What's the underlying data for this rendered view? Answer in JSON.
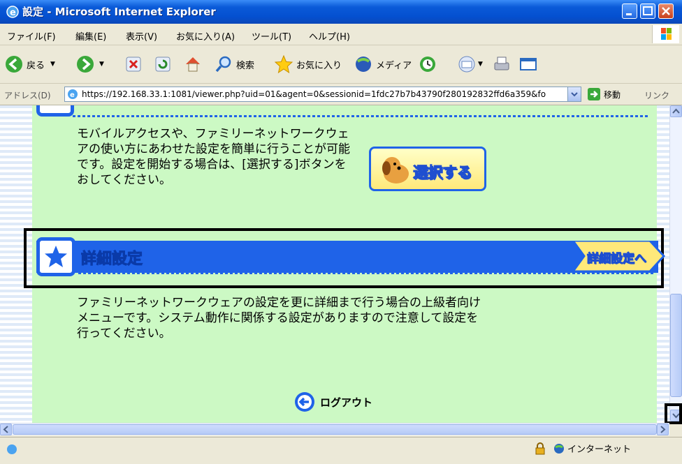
{
  "window": {
    "title": "設定 - Microsoft Internet Explorer"
  },
  "menu": {
    "items": [
      "ファイル(F)",
      "編集(E)",
      "表示(V)",
      "お気に入り(A)",
      "ツール(T)",
      "ヘルプ(H)"
    ]
  },
  "toolbar": {
    "back": "戻る",
    "search": "検索",
    "favorites": "お気に入り",
    "media": "メディア"
  },
  "address": {
    "label": "アドレス(D)",
    "url": "https://192.168.33.1:1081/viewer.php?uid=01&agent=0&sessionid=1fdc27b7b43790f280192832ffd6a359&fo",
    "go": "移動",
    "links": "リンク"
  },
  "content": {
    "intro_text": "モバイルアクセスや、ファミリーネットワークウェアの使い方にあわせた設定を簡単に行うことが可能です。設定を開始する場合は、[選択する]ボタンをおしてください。",
    "select_button": "選択する",
    "advanced_heading": "詳細設定",
    "advanced_link": "詳細設定へ",
    "advanced_text": "ファミリーネットワークウェアの設定を更に詳細まで行う場合の上級者向けメニューです。システム動作に関係する設定がありますので注意して設定を行ってください。",
    "logout": "ログアウト"
  },
  "status": {
    "zone": "インターネット"
  },
  "colors": {
    "accent_blue": "#1f63e8",
    "page_green": "#ccf9c4",
    "titlebar_blue": "#0a5ad8"
  },
  "icons": [
    "ie-icon",
    "back-icon",
    "forward-icon",
    "stop-icon",
    "refresh-icon",
    "home-icon",
    "search-icon",
    "favorites-star-icon",
    "media-icon",
    "history-icon",
    "mail-icon",
    "print-icon",
    "edit-icon",
    "go-arrow-icon",
    "lock-icon",
    "globe-icon",
    "star-icon",
    "dog-icon",
    "logout-arrow-icon"
  ]
}
